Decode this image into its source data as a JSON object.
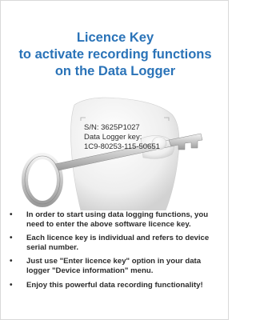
{
  "title": {
    "line1": "Licence Key",
    "line2": "to activate recording functions",
    "line3": "on the Data Logger"
  },
  "key_info": {
    "serial": "S/N: 3625P1027",
    "key_label": "Data Logger key:",
    "key_value": "1C9-80253-115-50651"
  },
  "bullets": [
    "In order to start using data logging functions, you need to enter the above software licence key.",
    "Each licence key is individual and refers to device serial number.",
    "Just use \"Enter licence key\" option in your data logger \"Device information\" menu.",
    "Enjoy this powerful data recording functionality!"
  ],
  "illustration": {
    "icon": "figure-holding-key-icon"
  },
  "colors": {
    "title": "#2a73b8",
    "text": "#2c2c2c",
    "border": "#d9d9d9"
  }
}
